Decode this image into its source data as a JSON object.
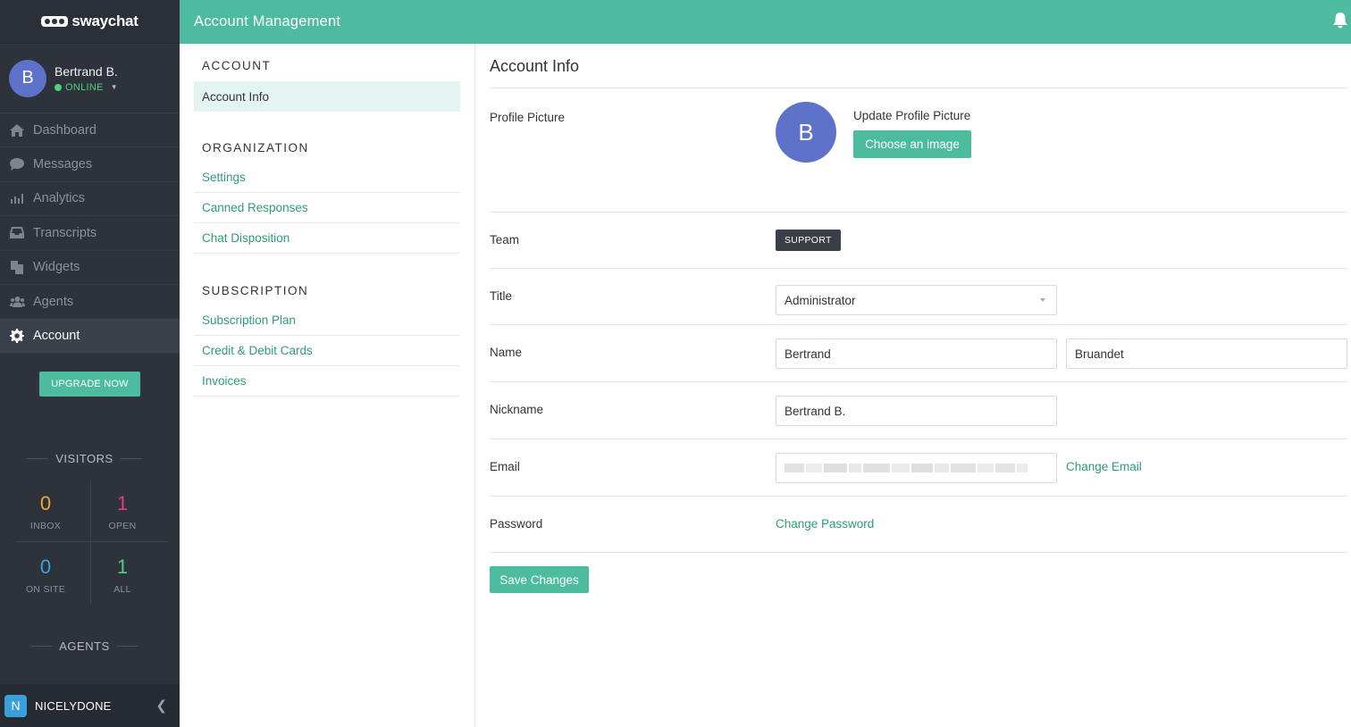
{
  "brand": {
    "name": "swaychat"
  },
  "user": {
    "name": "Bertrand B.",
    "initial": "B",
    "status": "ONLINE"
  },
  "nav": [
    {
      "label": "Dashboard",
      "icon": "home-icon"
    },
    {
      "label": "Messages",
      "icon": "chat-icon"
    },
    {
      "label": "Analytics",
      "icon": "bar-chart-icon"
    },
    {
      "label": "Transcripts",
      "icon": "inbox-icon"
    },
    {
      "label": "Widgets",
      "icon": "copy-icon"
    },
    {
      "label": "Agents",
      "icon": "users-icon"
    },
    {
      "label": "Account",
      "icon": "gear-icon",
      "active": true
    }
  ],
  "upgrade_label": "UPGRADE NOW",
  "visitors": {
    "title": "VISITORS",
    "stats": [
      {
        "value": "0",
        "label": "INBOX",
        "color": "#f0a830"
      },
      {
        "value": "1",
        "label": "OPEN",
        "color": "#e0407a"
      },
      {
        "value": "0",
        "label": "ON SITE",
        "color": "#3aa0dc"
      },
      {
        "value": "1",
        "label": "ALL",
        "color": "#4bd17e"
      }
    ]
  },
  "agents_title": "AGENTS",
  "org": {
    "initial": "N",
    "name": "NICELYDONE"
  },
  "topbar": {
    "title": "Account Management"
  },
  "settings_menu": {
    "account": {
      "heading": "ACCOUNT",
      "items": [
        "Account Info"
      ]
    },
    "organization": {
      "heading": "ORGANIZATION",
      "items": [
        "Settings",
        "Canned Responses",
        "Chat Disposition"
      ]
    },
    "subscription": {
      "heading": "SUBSCRIPTION",
      "items": [
        "Subscription Plan",
        "Credit & Debit Cards",
        "Invoices"
      ]
    }
  },
  "form": {
    "title": "Account Info",
    "profile_picture": {
      "label": "Profile Picture",
      "initial": "B",
      "update_title": "Update Profile Picture",
      "button": "Choose an image"
    },
    "team": {
      "label": "Team",
      "value": "SUPPORT"
    },
    "title_field": {
      "label": "Title",
      "value": "Administrator"
    },
    "name": {
      "label": "Name",
      "first": "Bertrand",
      "last": "Bruandet"
    },
    "nickname": {
      "label": "Nickname",
      "value": "Bertrand B."
    },
    "email": {
      "label": "Email",
      "change_link": "Change Email"
    },
    "password": {
      "label": "Password",
      "change_link": "Change Password"
    },
    "save_button": "Save Changes"
  },
  "colors": {
    "accent": "#4dbc9e",
    "sidebar_bg": "#2d323b",
    "link": "#2f9a7d",
    "avatar": "#5e72c9"
  }
}
